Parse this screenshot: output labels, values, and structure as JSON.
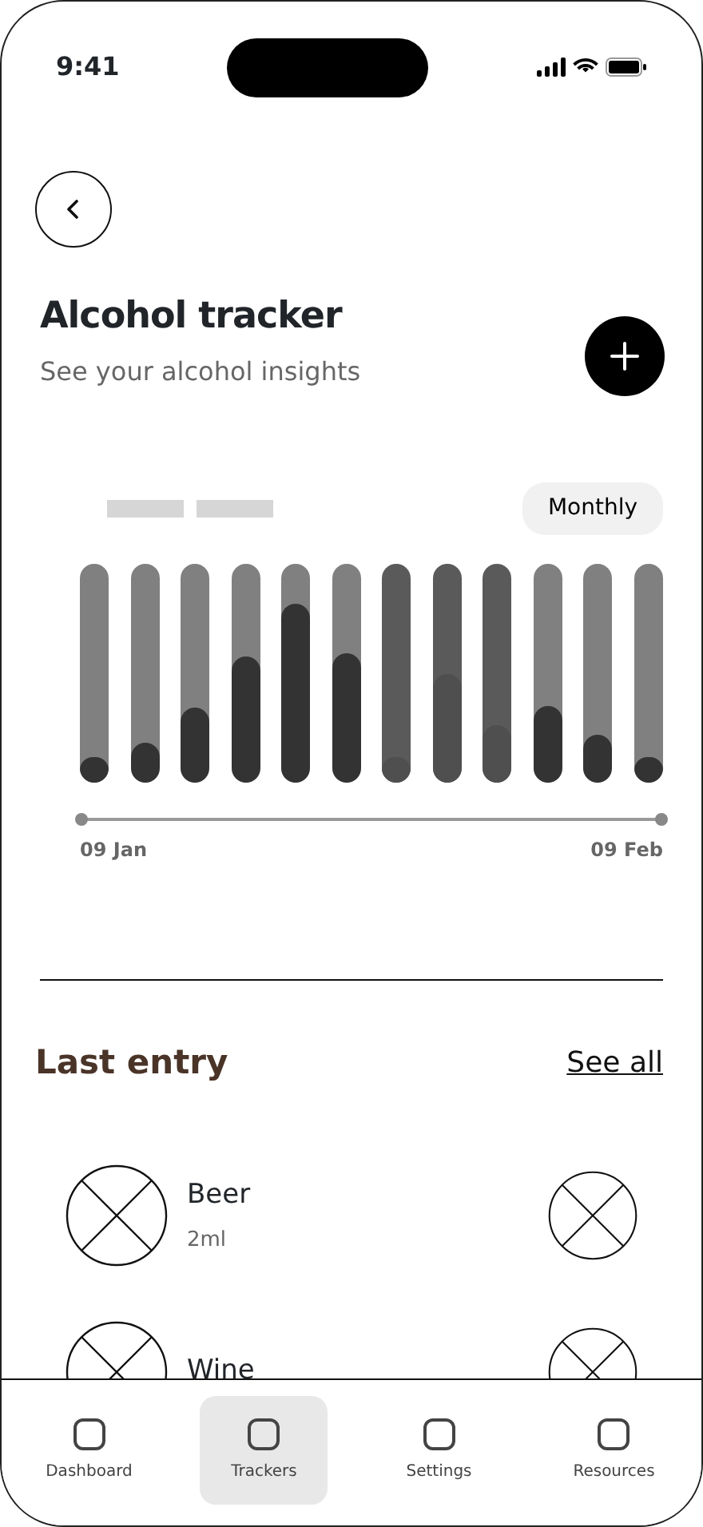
{
  "status_bar": {
    "time": "9:41"
  },
  "header": {
    "title": "Alcohol tracker",
    "subtitle": "See your alcohol insights"
  },
  "chart": {
    "period": "Monthly",
    "start_label": "09 Jan",
    "end_label": "09 Feb",
    "bars": [
      {
        "kind": "normal",
        "level": 0.12
      },
      {
        "kind": "normal",
        "level": 0.18
      },
      {
        "kind": "normal",
        "level": 0.34
      },
      {
        "kind": "normal",
        "level": 0.58
      },
      {
        "kind": "normal",
        "level": 0.82
      },
      {
        "kind": "normal",
        "level": 0.59
      },
      {
        "kind": "muted",
        "level": 0.12
      },
      {
        "kind": "muted",
        "level": 0.5
      },
      {
        "kind": "muted",
        "level": 0.26
      },
      {
        "kind": "normal",
        "level": 0.35
      },
      {
        "kind": "normal",
        "level": 0.22
      },
      {
        "kind": "normal",
        "level": 0.12
      }
    ]
  },
  "last_entry": {
    "title": "Last entry",
    "link": "See all",
    "entries": [
      {
        "name": "Beer",
        "amount": "2ml"
      },
      {
        "name": "Wine"
      }
    ]
  },
  "bottom_nav": [
    {
      "label": "Dashboard",
      "selected": false
    },
    {
      "label": "Trackers",
      "selected": true
    },
    {
      "label": "Settings",
      "selected": false
    },
    {
      "label": "Resources",
      "selected": false
    }
  ]
}
